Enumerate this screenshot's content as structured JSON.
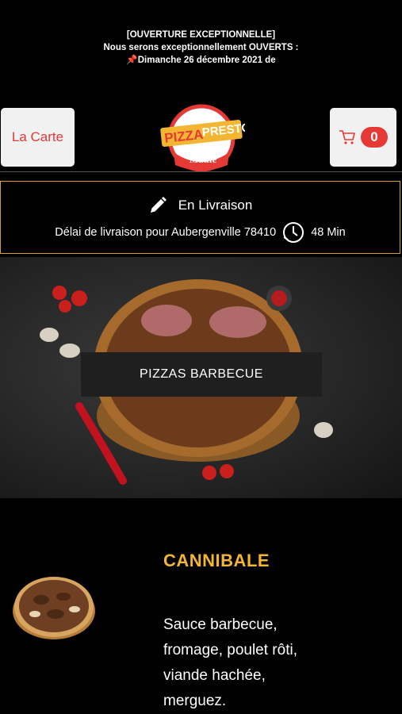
{
  "announcement": {
    "line1": "[OUVERTURE EXCEPTIONNELLE]",
    "line2": "Nous serons exceptionnellement OUVERTS :",
    "line3": "Dimanche 26 décembre 2021 de"
  },
  "header": {
    "menu_label": "La Carte",
    "cart_count": "0",
    "logo": {
      "word1": "PIZZA",
      "word2": "PRESTO",
      "word3": "Maule"
    }
  },
  "delivery": {
    "mode": "En Livraison",
    "info": "Délai de livraison pour Aubergenville 78410",
    "time": "48 Min"
  },
  "category": {
    "title": "PIZZAS BARBECUE"
  },
  "product": {
    "name": "CANNIBALE",
    "description": "Sauce barbecue, fromage, poulet rôti, viande hachée, merguez."
  },
  "colors": {
    "accent": "#e53935",
    "gold": "#f2b632",
    "border": "#d9a02a"
  }
}
